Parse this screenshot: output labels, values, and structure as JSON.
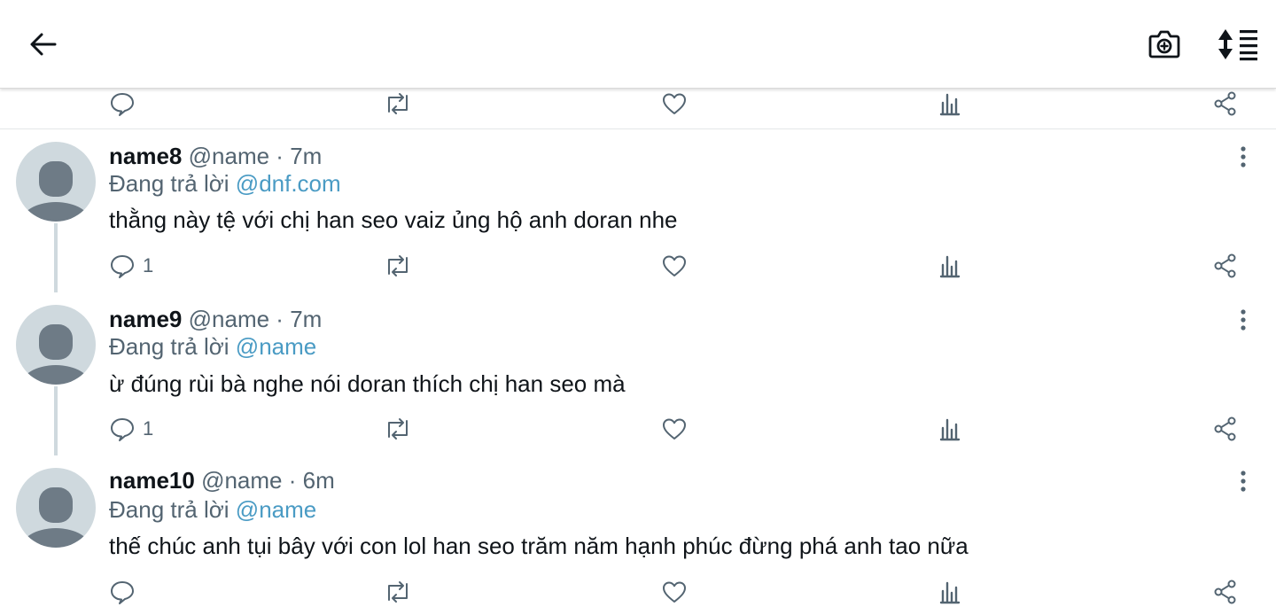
{
  "toolbar": {
    "back_icon": "arrow-left-icon",
    "camera_icon": "camera-plus-icon",
    "sort_icon": "sort-list-icon"
  },
  "colors": {
    "mention": "#4a9bc4",
    "secondary_text": "#536471",
    "avatar_bg": "#cfd9de",
    "avatar_fg": "#6e7b86"
  },
  "replies": [
    {
      "username": "name8",
      "handle": "@name",
      "separator": "·",
      "time": "7m",
      "replying_prefix": "Đang trả lời",
      "replying_to": "@dnf.com",
      "text": "thằng này tệ với chị han seo vaiz ủng hộ anh doran nhe",
      "reply_count": "1"
    },
    {
      "username": "name9",
      "handle": "@name",
      "separator": "·",
      "time": "7m",
      "replying_prefix": "Đang trả lời",
      "replying_to": "@name",
      "text": "ừ đúng rùi bà nghe nói doran thích chị han seo mà",
      "reply_count": "1"
    },
    {
      "username": "name10",
      "handle": "@name",
      "separator": "·",
      "time": "6m",
      "replying_prefix": "Đang trả lời",
      "replying_to": "@name",
      "text": "thế chúc anh tụi bây với con lol han seo trăm năm hạnh phúc đừng phá anh tao nữa",
      "reply_count": ""
    }
  ]
}
